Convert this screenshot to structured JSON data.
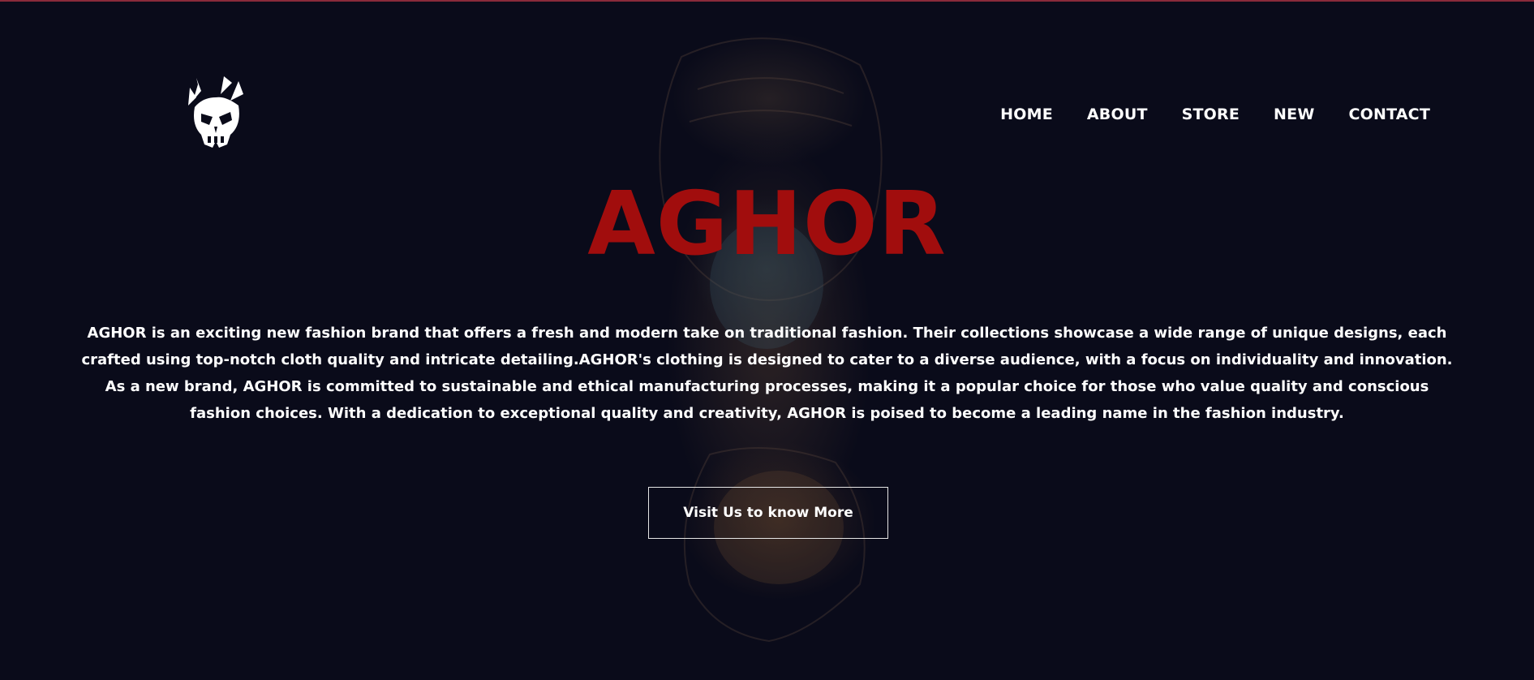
{
  "header": {
    "logo_icon": "skull-logo-icon",
    "nav": [
      {
        "label": "HOME"
      },
      {
        "label": "ABOUT"
      },
      {
        "label": "STORE"
      },
      {
        "label": "NEW"
      },
      {
        "label": "CONTACT"
      }
    ]
  },
  "hero": {
    "title": "AGHOR",
    "description": "AGHOR is an exciting new fashion brand that offers a fresh and modern take on traditional fashion. Their collections showcase a wide range of unique designs, each crafted using top-notch cloth quality and intricate detailing.AGHOR's clothing is designed to cater to a diverse audience, with a focus on individuality and innovation. As a new brand, AGHOR is committed to sustainable and ethical manufacturing processes, making it a popular choice for those who value quality and conscious fashion choices. With a dedication to exceptional quality and creativity, AGHOR is poised to become a leading name in the fashion industry.",
    "cta_label": "Visit Us to know More",
    "background_image": "statue-head-background"
  },
  "colors": {
    "background": "#0a0b1a",
    "title": "#a10d0d",
    "text": "#ffffff",
    "top_border": "#8a2a3a"
  }
}
